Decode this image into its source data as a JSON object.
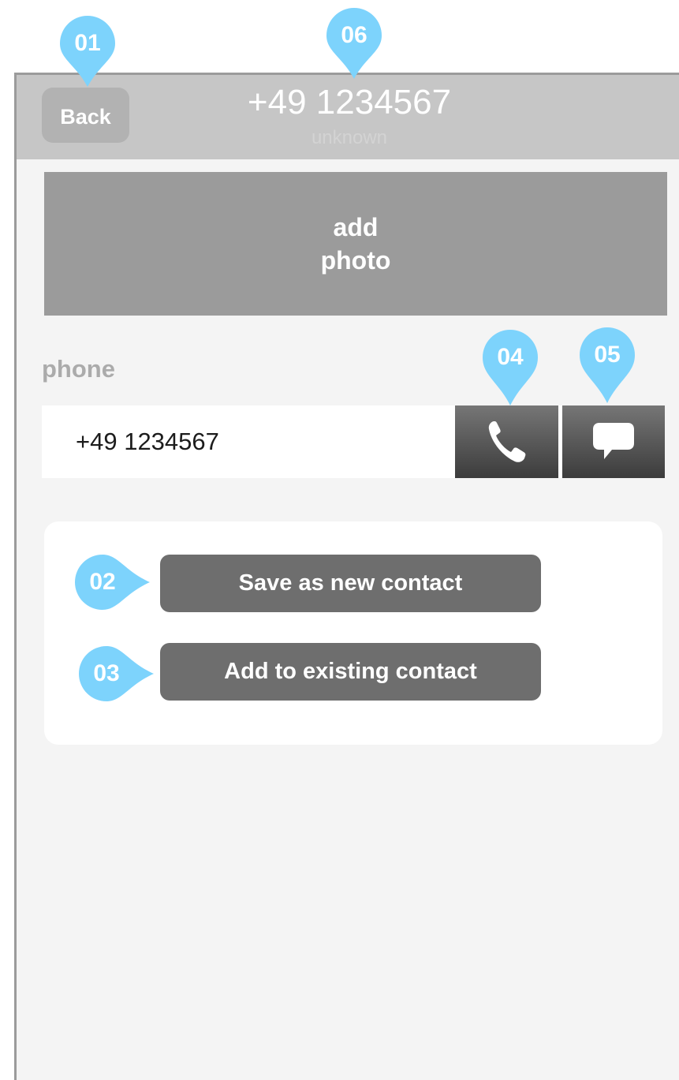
{
  "header": {
    "back_label": "Back",
    "title": "+49 1234567",
    "subtitle": "unknown"
  },
  "photo": {
    "line1": "add",
    "line2": "photo"
  },
  "phone_section": {
    "label": "phone",
    "value": "+49 1234567",
    "call_icon": "phone-icon",
    "message_icon": "speech-bubble-icon"
  },
  "actions": {
    "save_new": "Save as new contact",
    "add_existing": "Add to existing contact"
  },
  "callouts": {
    "c01": "01",
    "c02": "02",
    "c03": "03",
    "c04": "04",
    "c05": "05",
    "c06": "06"
  },
  "colors": {
    "callout": "#7dd3fc",
    "header": "#c6c6c6",
    "button": "#6e6e6e"
  }
}
